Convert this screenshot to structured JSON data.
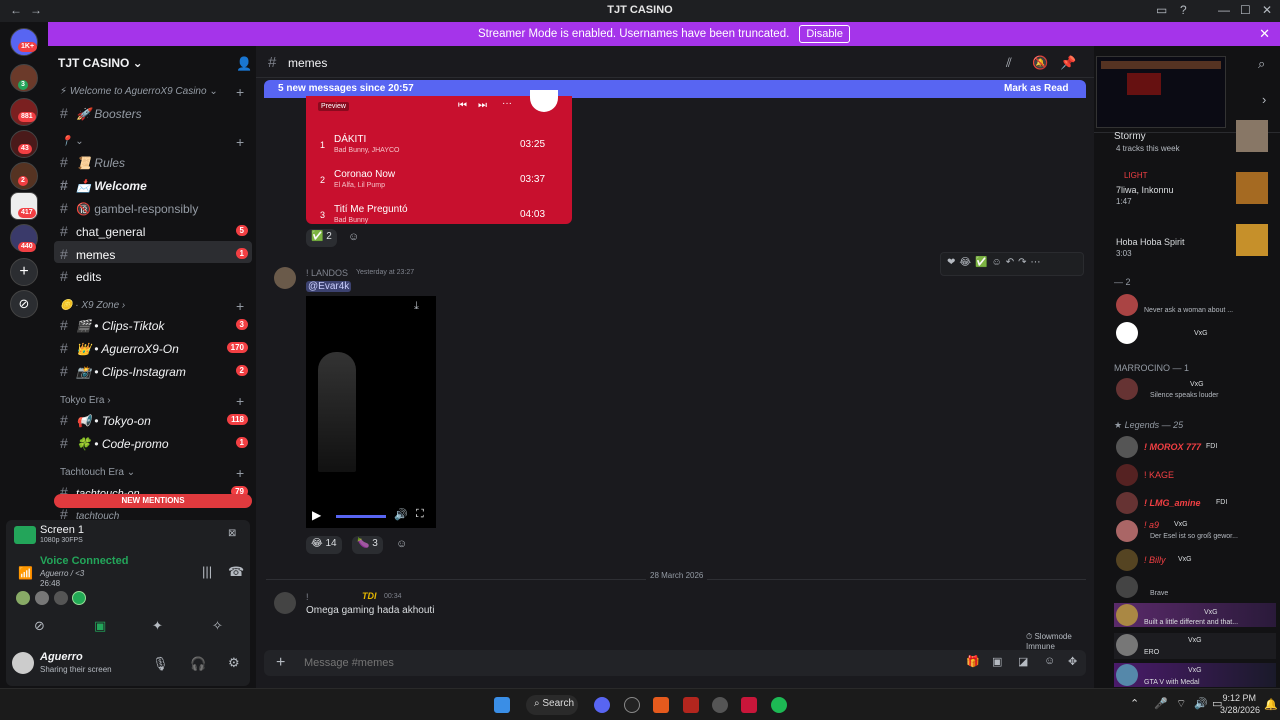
{
  "window": {
    "title": "TJT CASINO"
  },
  "banner": {
    "text": "Streamer Mode is enabled. Usernames have been truncated.",
    "disable": "Disable"
  },
  "guild_badges": [
    "1K+",
    "3",
    "881",
    "43",
    "2",
    "417",
    "440"
  ],
  "server": {
    "name": "TJT CASINO",
    "cat1": "Welcome to AguerroX9 Casino",
    "channels": [
      {
        "name": "Boosters",
        "emoji": "🚀"
      },
      {
        "name": "Rules",
        "emoji": "📜"
      },
      {
        "name": "Welcome",
        "emoji": "📩"
      },
      {
        "name": "gambel-responsibly",
        "emoji": "🔞"
      },
      {
        "name": "chat_general",
        "badge": "5"
      },
      {
        "name": "memes",
        "badge": "1"
      },
      {
        "name": "edits"
      }
    ],
    "cat2": "X9 Zone",
    "zone": [
      {
        "name": "• Clips-Tiktok",
        "badge": "3",
        "emoji": "🎬"
      },
      {
        "name": "• AguerroX9-On",
        "badge": "170",
        "emoji": "👑"
      },
      {
        "name": "• Clips-Instagram",
        "badge": "2",
        "emoji": "📸"
      }
    ],
    "cat3": "Tokyo Era",
    "tokyo": [
      {
        "name": "• Tokyo-on",
        "badge": "118",
        "emoji": "📢"
      },
      {
        "name": "• Code-promo",
        "badge": "1",
        "emoji": "🍀"
      }
    ],
    "cat4": "Tachtouch Era",
    "tach": [
      {
        "name": "tachtouch-on",
        "badge": "79"
      },
      {
        "name": "tachtouch"
      }
    ],
    "new_mentions": "NEW MENTIONS"
  },
  "stream": {
    "title": "Screen 1",
    "quality": "1080p 30FPS"
  },
  "voice": {
    "status": "Voice Connected",
    "channel": "Aguerro / <3",
    "time": "26:48"
  },
  "user": {
    "name": "Aguerro",
    "status": "Sharing their screen"
  },
  "channel_header": {
    "name": "memes"
  },
  "new_messages": {
    "text": "5 new messages since 20:57",
    "mark": "Mark as Read"
  },
  "spotify": {
    "preview": "Preview",
    "tracks": [
      {
        "n": "1",
        "title": "DÁKITI",
        "artist": "Bad Bunny, JHAYCO",
        "dur": "03:25"
      },
      {
        "n": "2",
        "title": "Coronao Now",
        "artist": "El Alfa, Lil Pump",
        "dur": "03:37"
      },
      {
        "n": "3",
        "title": "Tití Me Preguntó",
        "artist": "Bad Bunny",
        "dur": "04:03"
      }
    ]
  },
  "reactions1": {
    "check": "2"
  },
  "message2": {
    "author": "! LANDOS",
    "time": "Yesterday at 23:27",
    "mention": "@Evar4k",
    "r1": "14",
    "r2": "3"
  },
  "divider": "28 March 2026",
  "message3": {
    "author": "TDI",
    "prefix": "!",
    "time": "00:34",
    "text": "Omega gaming hada akhouti"
  },
  "slowmode": "Slowmode Immune",
  "composer": {
    "placeholder": "Message #memes"
  },
  "members": {
    "activity": [
      {
        "name": "Stormy",
        "sub": "4 tracks this week"
      },
      {
        "name": "LIGHT",
        "sub": "7liwa, Inkonnu",
        "time": "1:47"
      },
      {
        "name": "Hoba Hoba Spirit",
        "time": "3:03"
      }
    ],
    "g1": "— 2",
    "g1m": [
      {
        "sub": "Never ask a woman about ..."
      },
      {
        "tag": "VxG"
      }
    ],
    "g2": "MARROCINO — 1",
    "g2m": [
      {
        "tag": "VxG",
        "sub": "Silence speaks louder"
      }
    ],
    "g3": "Legends — 25",
    "g3m": [
      {
        "name": "! MOROX 777",
        "tag": "FDI"
      },
      {
        "name": "! KAGE"
      },
      {
        "name": "! LMG_amine",
        "tag": "FDI"
      },
      {
        "name": "! a9",
        "tag": "VxG",
        "sub": "Der Esel ist so groß gewor..."
      },
      {
        "name": "! Billy",
        "tag": "VxG"
      },
      {
        "name": "",
        "sub": "Brave"
      },
      {
        "name": "",
        "tag": "VxG",
        "sub": "Built a little different and that..."
      },
      {
        "name": "",
        "tag": "VxG",
        "sub": "ERO"
      },
      {
        "name": "",
        "tag": "VxG",
        "sub": "GTA V with Medal"
      }
    ]
  },
  "taskbar": {
    "search": "Search",
    "time": "9:12 PM",
    "date": "3/28/2026"
  }
}
